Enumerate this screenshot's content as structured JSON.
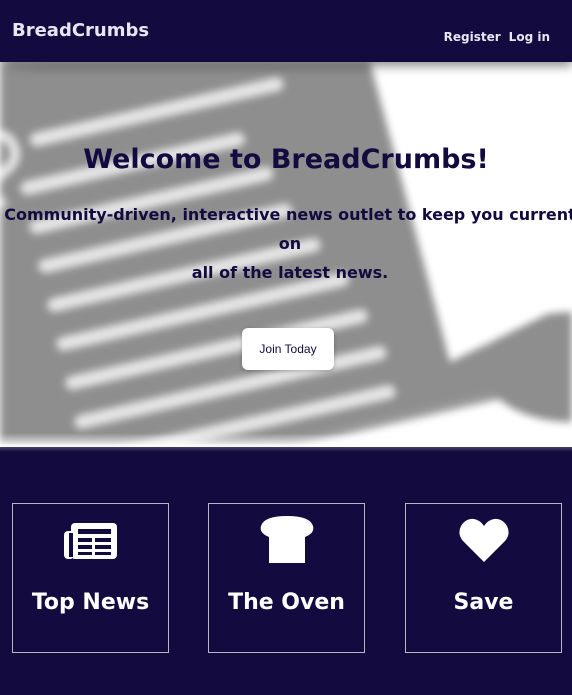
{
  "header": {
    "brand": "BreadCrumbs",
    "nav": {
      "register": "Register",
      "login": "Log in"
    }
  },
  "hero": {
    "title": "Welcome to BreadCrumbs!",
    "subtitle_line1": "Community-driven, interactive news outlet to keep you current on",
    "subtitle_line2": "all of the latest news.",
    "cta_label": "Join Today"
  },
  "features": [
    {
      "label": "Top News",
      "icon": "newspaper-icon"
    },
    {
      "label": "The Oven",
      "icon": "bread-icon"
    },
    {
      "label": "Save",
      "icon": "heart-icon"
    }
  ],
  "colors": {
    "primary": "#130a3f",
    "text_light": "#ffffff",
    "border": "#b9b6cc",
    "hero_bg": "#ffffff"
  }
}
